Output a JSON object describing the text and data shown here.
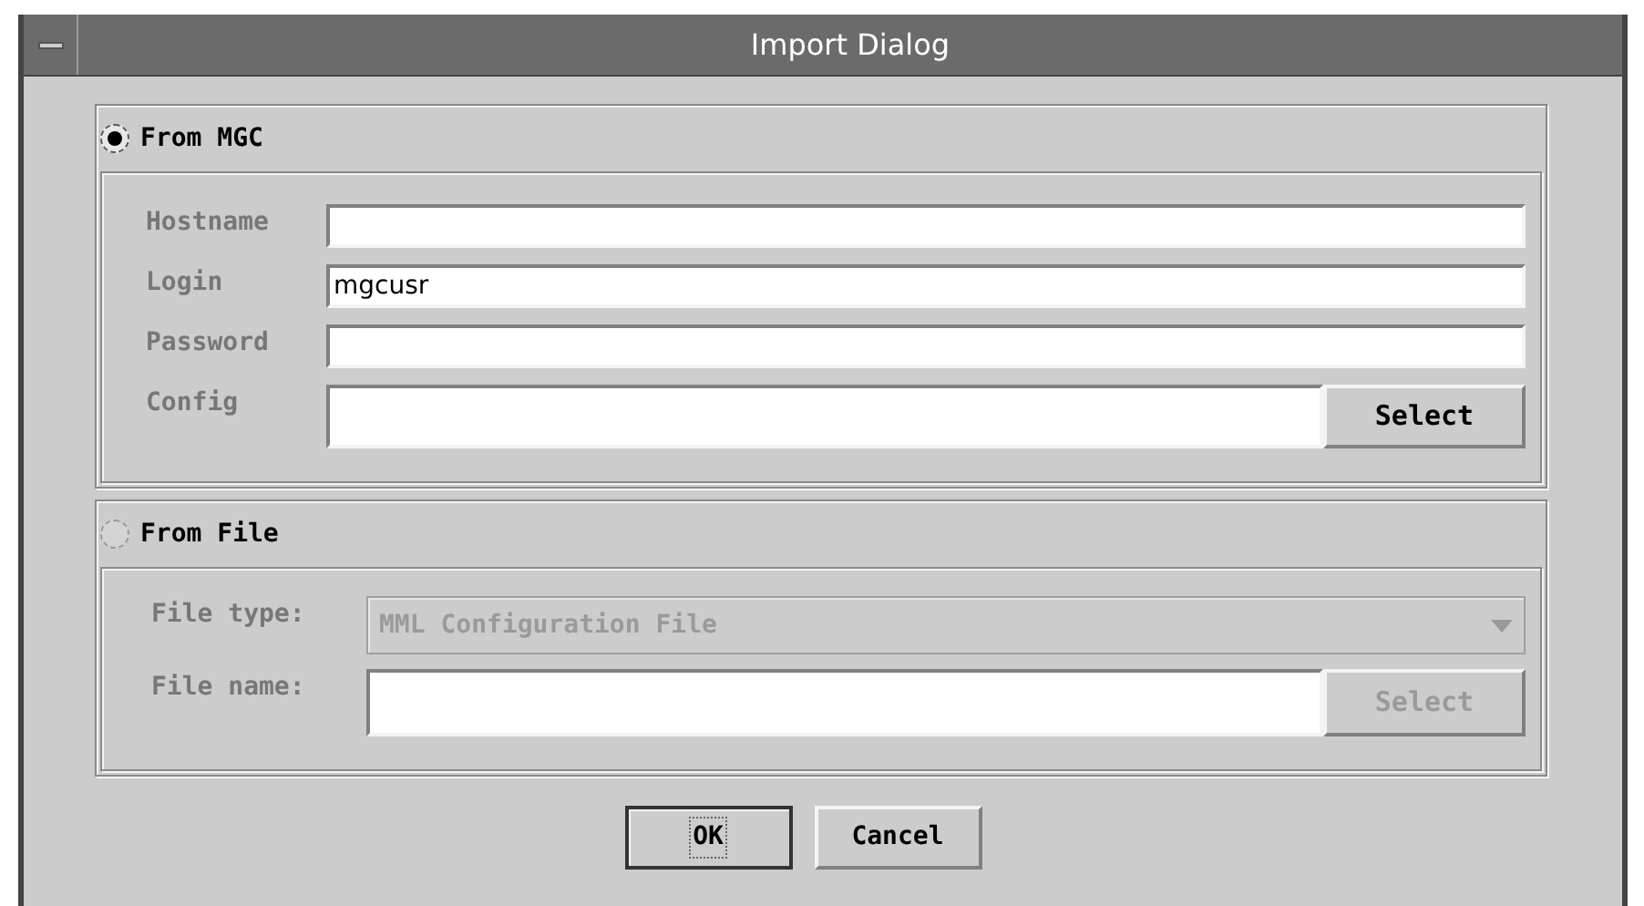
{
  "window": {
    "title": "Import Dialog"
  },
  "from_mgc": {
    "label": "From MGC",
    "selected": true,
    "disabled": false,
    "fields": [
      {
        "label": "Hostname"
      },
      {
        "label": "Login",
        "value": "mgcusr"
      },
      {
        "label": "Password"
      },
      {
        "label": "Config",
        "button": "Select"
      }
    ]
  },
  "from_file": {
    "label": "From File",
    "selected": false,
    "disabled": true,
    "file_type": {
      "label": "File type:",
      "value": "MML Configuration File"
    },
    "file_name": {
      "label": "File name:",
      "button": "Select"
    }
  },
  "buttons": [
    {
      "label": "OK",
      "default": true
    },
    {
      "label": "Cancel",
      "default": false
    }
  ]
}
